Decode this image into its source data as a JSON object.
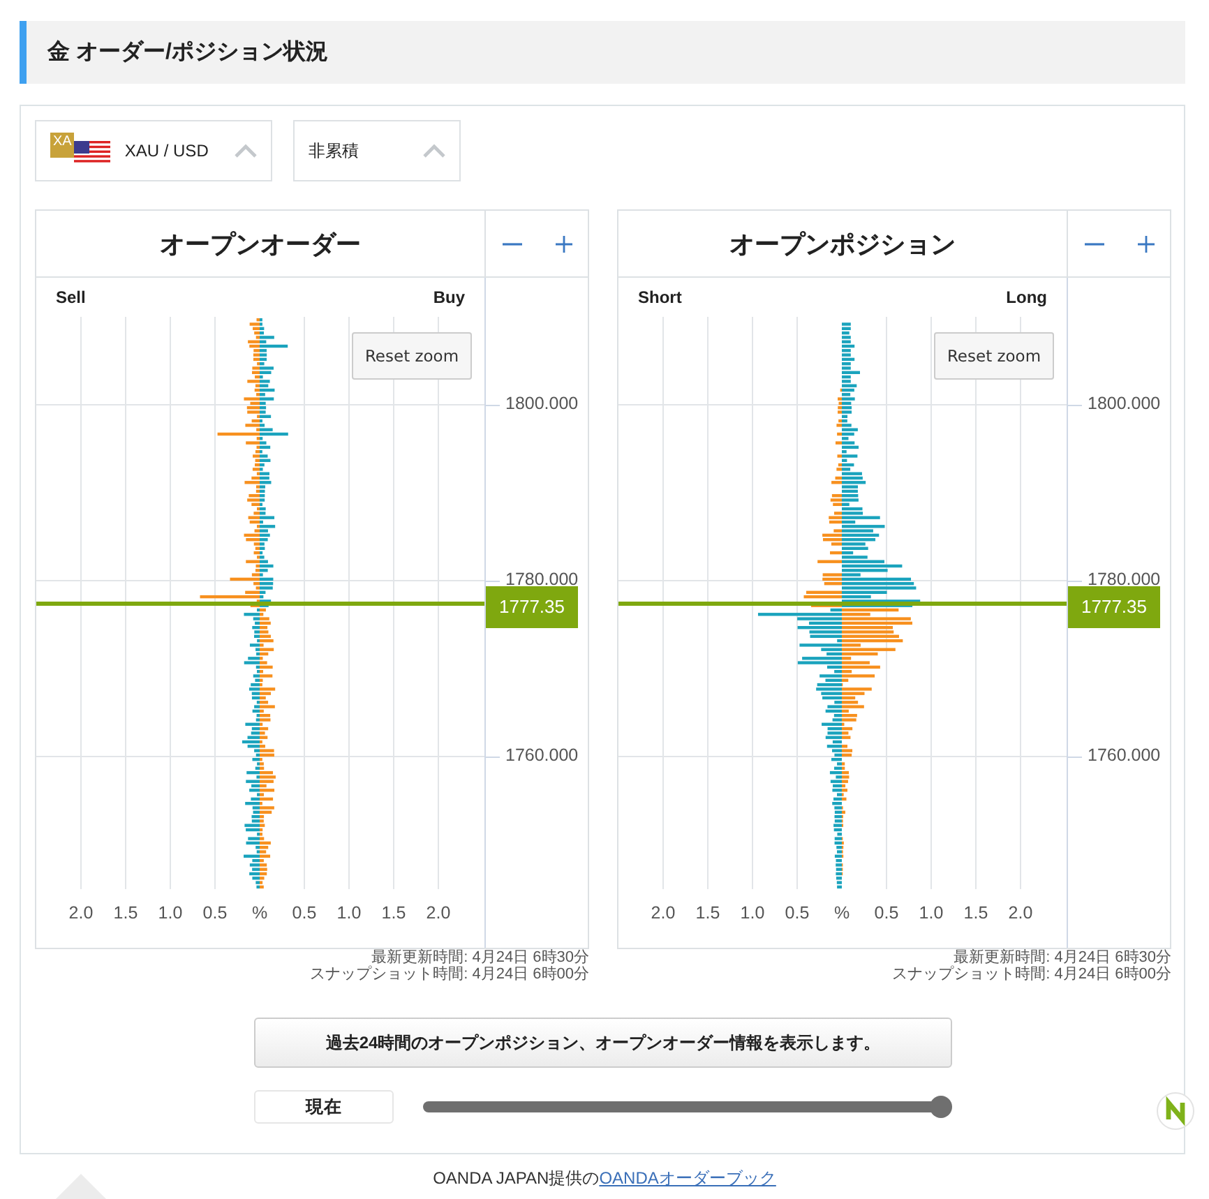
{
  "header": {
    "title": "金 オーダー/ポジション状況"
  },
  "selectors": [
    {
      "kind": "instrument",
      "badge": "XA",
      "label": "XAU / USD"
    },
    {
      "kind": "plain",
      "label": "非累積"
    }
  ],
  "charts": [
    {
      "kind": "order",
      "title": "オープンオーダー",
      "left_label": "Sell",
      "right_label": "Buy",
      "reset_button": "Reset zoom",
      "price_ticks": [
        "1800.000",
        "1780.000",
        "1760.000"
      ],
      "current_price": "1777.35",
      "x_ticks": [
        "2.0",
        "1.5",
        "1.0",
        "0.5",
        "%",
        "0.5",
        "1.0",
        "1.5",
        "2.0"
      ],
      "updated": "最新更新時間: 4月24日 6時30分",
      "snapshot": "スナップショット時間: 4月24日 6時00分"
    },
    {
      "kind": "position",
      "title": "オープンポジション",
      "left_label": "Short",
      "right_label": "Long",
      "reset_button": "Reset zoom",
      "price_ticks": [
        "1800.000",
        "1780.000",
        "1760.000"
      ],
      "current_price": "1777.35",
      "x_ticks": [
        "2.0",
        "1.5",
        "1.0",
        "0.5",
        "%",
        "0.5",
        "1.0",
        "1.5",
        "2.0"
      ],
      "updated": "最新更新時間: 4月24日 6時30分",
      "snapshot": "スナップショット時間: 4月24日 6時00分"
    }
  ],
  "history_button": "過去24時間のオープンポジション、オープンオーダー情報を表示します。",
  "slider": {
    "label": "現在",
    "level": 1
  },
  "footer": {
    "text": "OANDA JAPAN提供の",
    "link": "OANDAオーダーブック"
  }
}
